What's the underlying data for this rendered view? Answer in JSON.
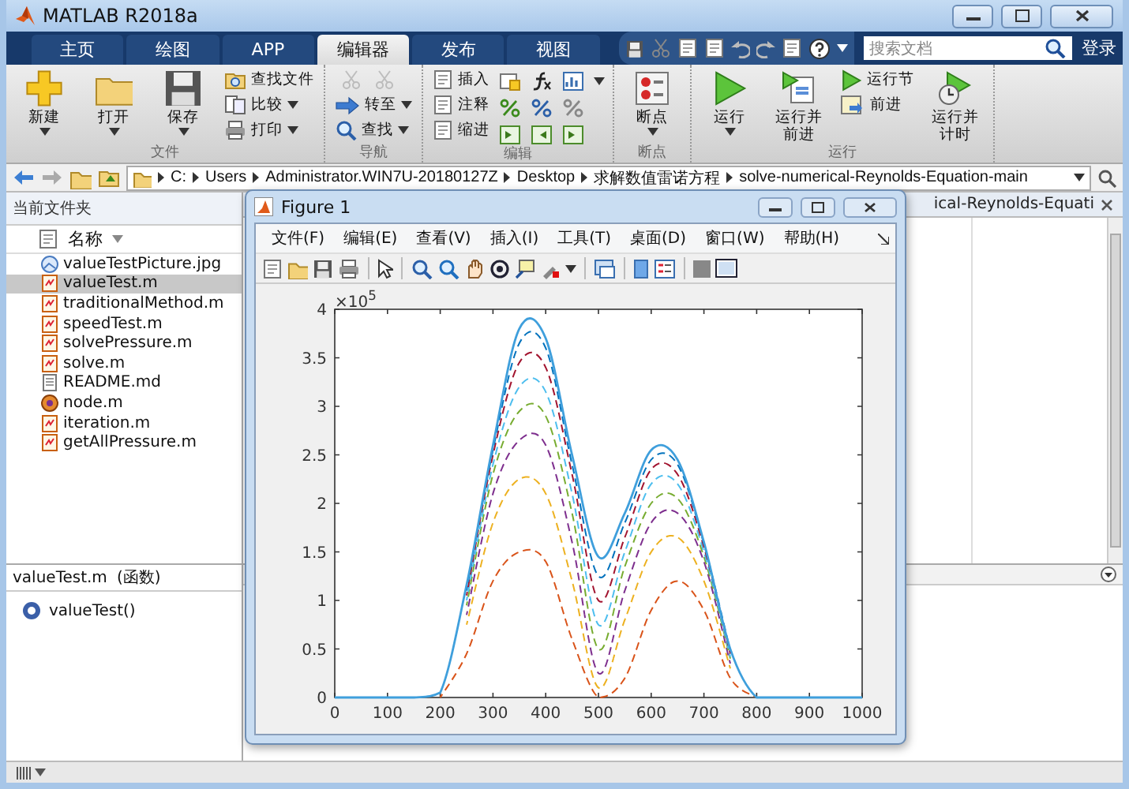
{
  "window": {
    "title": "MATLAB R2018a"
  },
  "ribbon": {
    "tabs": [
      {
        "label": "主页",
        "selected": false
      },
      {
        "label": "绘图",
        "selected": false
      },
      {
        "label": "APP",
        "selected": false
      },
      {
        "label": "编辑器",
        "selected": true
      },
      {
        "label": "发布",
        "selected": false
      },
      {
        "label": "视图",
        "selected": false
      }
    ],
    "search": {
      "placeholder": "搜索文档"
    },
    "login_button": "登录",
    "groups": [
      {
        "label": "文件",
        "columns": [
          {
            "kind": "large",
            "label": "新建",
            "dropdown": true
          },
          {
            "kind": "large",
            "label": "打开",
            "dropdown": true
          },
          {
            "kind": "large",
            "label": "保存",
            "dropdown": true
          },
          {
            "kind": "stack",
            "items": [
              {
                "kind": "text",
                "label": "查找文件",
                "dropdown": false
              },
              {
                "kind": "text",
                "label": "比较",
                "dropdown": true
              },
              {
                "kind": "text",
                "label": "打印",
                "dropdown": true
              }
            ]
          }
        ]
      },
      {
        "label": "导航",
        "columns": [
          {
            "kind": "stack",
            "items": [
              {
                "kind": "disabled_icons"
              },
              {
                "kind": "text",
                "label": "转至",
                "dropdown": true
              },
              {
                "kind": "text",
                "label": "查找",
                "dropdown": true
              }
            ]
          }
        ]
      },
      {
        "label": "编辑",
        "columns": [
          {
            "kind": "stack",
            "items": [
              {
                "kind": "text",
                "label": "插入",
                "dropdown": false
              },
              {
                "kind": "text",
                "label": "注释",
                "dropdown": false
              },
              {
                "kind": "text",
                "label": "缩进",
                "dropdown": false
              }
            ]
          },
          {
            "kind": "icon_grid"
          }
        ]
      },
      {
        "label": "断点",
        "columns": [
          {
            "kind": "large",
            "label": "断点",
            "dropdown": true
          }
        ]
      },
      {
        "label": "运行",
        "columns": [
          {
            "kind": "large",
            "label": "运行",
            "dropdown": true
          },
          {
            "kind": "large",
            "label": "运行并前进",
            "dropdown": false
          },
          {
            "kind": "stack",
            "items": [
              {
                "kind": "text",
                "label": "运行节",
                "dropdown": false
              },
              {
                "kind": "text",
                "label": "前进",
                "dropdown": false
              }
            ]
          },
          {
            "kind": "large",
            "label": "运行并计时",
            "dropdown": false
          }
        ]
      }
    ]
  },
  "address_bar": {
    "path": [
      "C:",
      "Users",
      "Administrator.WIN7U-20180127Z",
      "Desktop",
      "求解数值雷诺方程",
      "solve-numerical-Reynolds-Equation-main"
    ]
  },
  "file_panel": {
    "title": "当前文件夹",
    "column": "名称",
    "files": [
      {
        "name": "valueTestPicture.jpg",
        "kind": "image",
        "selected": false
      },
      {
        "name": "valueTest.m",
        "kind": "script",
        "selected": true
      },
      {
        "name": "traditionalMethod.m",
        "kind": "script",
        "selected": false
      },
      {
        "name": "speedTest.m",
        "kind": "script",
        "selected": false
      },
      {
        "name": "solvePressure.m",
        "kind": "script",
        "selected": false
      },
      {
        "name": "solve.m",
        "kind": "script",
        "selected": false
      },
      {
        "name": "README.md",
        "kind": "text",
        "selected": false
      },
      {
        "name": "node.m",
        "kind": "class",
        "selected": false
      },
      {
        "name": "iteration.m",
        "kind": "script",
        "selected": false
      },
      {
        "name": "getAllPressure.m",
        "kind": "script",
        "selected": false
      }
    ]
  },
  "details_panel": {
    "title": "valueTest.m",
    "subtitle": "(函数)",
    "items": [
      "valueTest()"
    ]
  },
  "editor": {
    "tab_title": "ical-Reynolds-Equati"
  },
  "figure": {
    "title": "Figure 1",
    "menu": [
      "文件(F)",
      "编辑(E)",
      "查看(V)",
      "插入(I)",
      "工具(T)",
      "桌面(D)",
      "窗口(W)",
      "帮助(H)"
    ],
    "exponent_label": "×10$^{5}$",
    "chart_data": {
      "type": "line",
      "x": [
        0,
        50,
        100,
        150,
        200,
        250,
        300,
        350,
        400,
        450,
        500,
        550,
        600,
        650,
        700,
        750,
        800,
        850,
        900,
        950,
        1000
      ],
      "xlim": [
        0,
        1000
      ],
      "ylim": [
        0,
        4
      ],
      "xticks": [
        0,
        100,
        200,
        300,
        400,
        500,
        600,
        700,
        800,
        900,
        1000
      ],
      "yticks": [
        0,
        0.5,
        1,
        1.5,
        2,
        2.5,
        3,
        3.5,
        4
      ],
      "series": [
        {
          "color": "#d95319",
          "line_style": "dashed",
          "values": [
            null,
            null,
            null,
            null,
            0,
            0.45,
            1.2,
            1.5,
            1.4,
            0.6,
            0,
            0.2,
            0.9,
            1.2,
            0.9,
            0.2,
            0,
            null,
            null,
            null,
            null
          ]
        },
        {
          "color": "#edb120",
          "line_style": "dashed",
          "values": [
            null,
            null,
            null,
            null,
            null,
            0.75,
            1.8,
            2.25,
            2.1,
            1.2,
            0.1,
            0.8,
            1.5,
            1.65,
            1.2,
            0.3,
            null,
            null,
            null,
            null,
            null
          ]
        },
        {
          "color": "#7e2f8e",
          "line_style": "dashed",
          "values": [
            null,
            null,
            null,
            null,
            null,
            0.85,
            2.1,
            2.65,
            2.6,
            1.6,
            0.25,
            1.1,
            1.8,
            1.9,
            1.4,
            0.35,
            null,
            null,
            null,
            null,
            null
          ]
        },
        {
          "color": "#77ac30",
          "line_style": "dashed",
          "values": [
            null,
            null,
            null,
            null,
            null,
            0.95,
            2.3,
            2.95,
            2.9,
            1.9,
            0.5,
            1.35,
            2,
            2.05,
            1.45,
            0.4,
            null,
            null,
            null,
            null,
            null
          ]
        },
        {
          "color": "#4dbeee",
          "line_style": "dashed",
          "values": [
            null,
            null,
            null,
            null,
            null,
            1,
            2.4,
            3.2,
            3.15,
            2.1,
            0.75,
            1.5,
            2.2,
            2.2,
            1.5,
            0.42,
            null,
            null,
            null,
            null,
            null
          ]
        },
        {
          "color": "#a2142f",
          "line_style": "dashed",
          "values": [
            null,
            null,
            null,
            null,
            null,
            1.05,
            2.5,
            3.45,
            3.4,
            2.3,
            1,
            1.65,
            2.35,
            2.3,
            1.55,
            0.45,
            null,
            null,
            null,
            null,
            null
          ]
        },
        {
          "color": "#0072bd",
          "line_style": "dashed",
          "values": [
            null,
            null,
            null,
            null,
            null,
            1.1,
            2.55,
            3.65,
            3.6,
            2.4,
            1.25,
            1.8,
            2.45,
            2.4,
            1.58,
            0.48,
            null,
            null,
            null,
            null,
            null
          ]
        },
        {
          "color": "#3f9fdc",
          "line_style": "solid",
          "values": [
            0,
            0,
            0,
            0,
            0.05,
            1.16,
            2.6,
            3.8,
            3.7,
            2.5,
            1.45,
            1.9,
            2.55,
            2.45,
            1.6,
            0.5,
            0,
            0,
            0,
            0,
            0
          ]
        }
      ]
    }
  }
}
